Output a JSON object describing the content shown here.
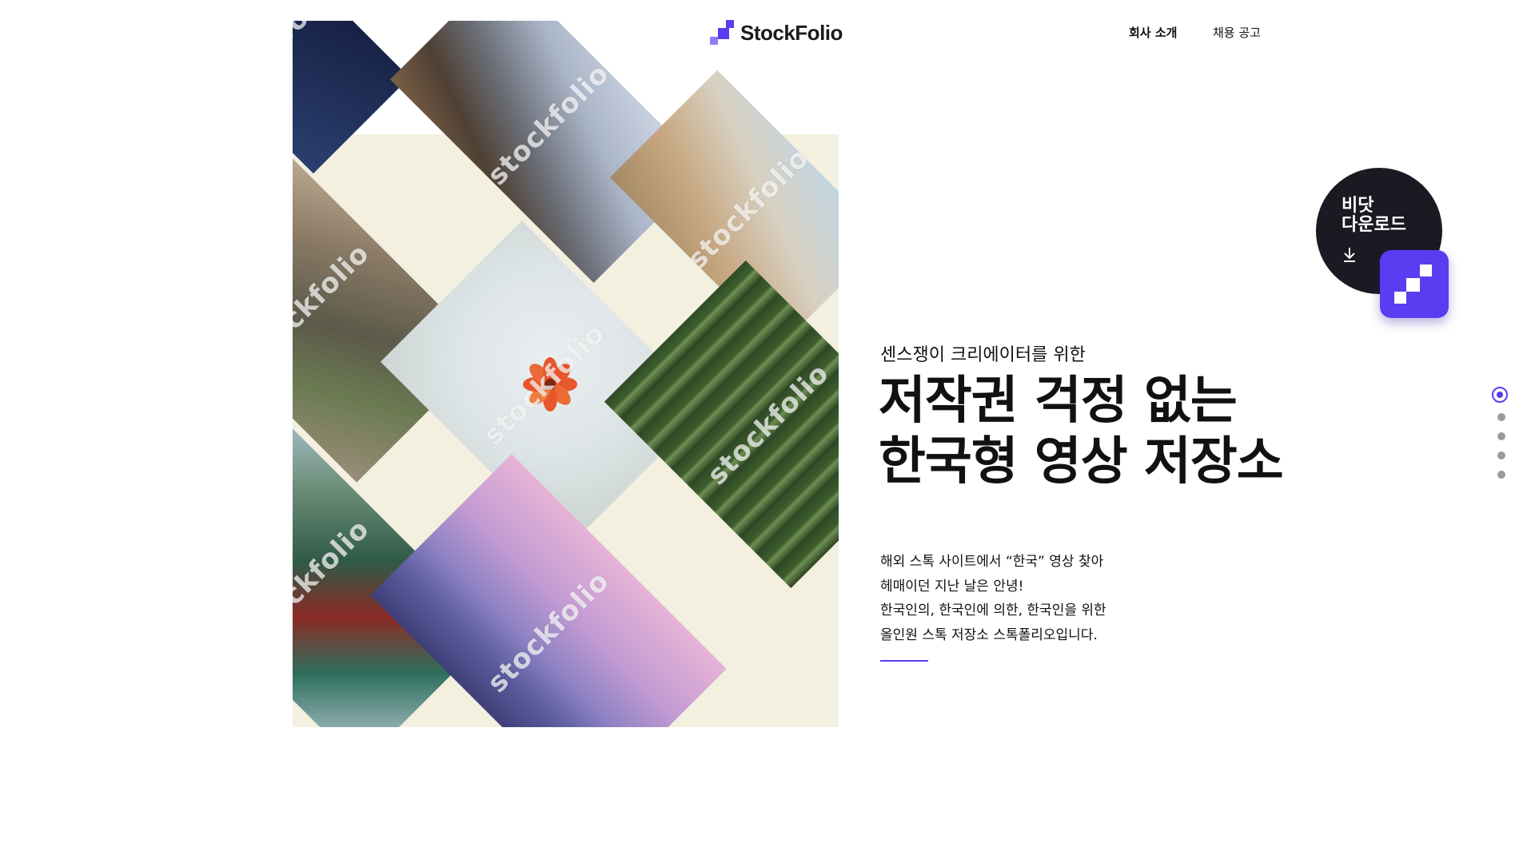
{
  "brand": {
    "name": "StockFolio",
    "accent_color": "#5b3cf0"
  },
  "nav": {
    "items": [
      {
        "label": "회사 소개",
        "active": true
      },
      {
        "label": "채용 공고",
        "active": false
      }
    ]
  },
  "hero": {
    "subtitle": "센스쟁이 크리에이터를 위한",
    "headline": [
      "저작권 걱정 없는",
      "한국형 영상 저장소"
    ],
    "description": [
      "해외 스톡 사이트에서 “한국” 영상 찾아",
      "헤매이던 지난 날은 안녕!",
      "한국인의, 한국인에 의한, 한국인을 위한",
      "올인원 스톡 저장소 스톡폴리오입니다."
    ]
  },
  "collage": {
    "watermark": "stockfolio",
    "photos": [
      {
        "subject": "night-city"
      },
      {
        "subject": "hanok-roof-mountains"
      },
      {
        "subject": "hanok-village"
      },
      {
        "subject": "pampas-grass"
      },
      {
        "subject": "cosmos-flower"
      },
      {
        "subject": "bamboo-forest"
      },
      {
        "subject": "palace-eaves"
      },
      {
        "subject": "city-skyline-dusk"
      }
    ]
  },
  "download_badge": {
    "line1": "비닷",
    "line2": "다운로드",
    "icon": "download-icon"
  },
  "pager": {
    "count": 5,
    "active_index": 0
  }
}
